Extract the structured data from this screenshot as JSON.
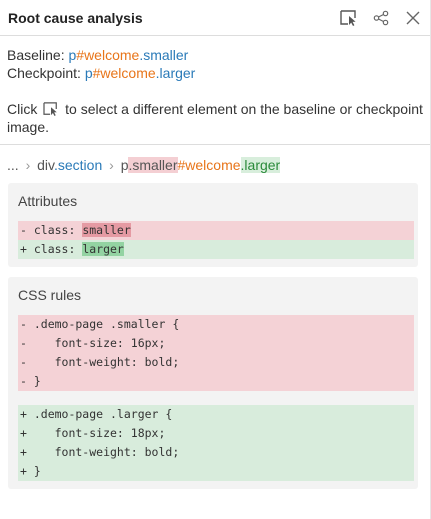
{
  "header": {
    "title": "Root cause analysis"
  },
  "info": {
    "baseline_label": "Baseline: ",
    "checkpoint_label": "Checkpoint: ",
    "baseline_tag": "p",
    "baseline_id": "#welcome",
    "baseline_class": ".smaller",
    "checkpoint_tag": "p",
    "checkpoint_id": "#welcome",
    "checkpoint_class": ".larger",
    "hint_before": "Click ",
    "hint_after": " to select a different element on the baseline or checkpoint image."
  },
  "breadcrumb": {
    "ellipsis": "...",
    "sep": "›",
    "parent_tag": "div",
    "parent_class": ".section",
    "elem_tag": "p",
    "elem_bad_class": ".smaller",
    "elem_id": "#welcome",
    "elem_good_class": ".larger"
  },
  "attributes": {
    "title": "Attributes",
    "del_prefix": "- class: ",
    "del_value": "smaller",
    "add_prefix": "+ class: ",
    "add_value": "larger"
  },
  "css_rules": {
    "title": "CSS rules",
    "removed": [
      "- .demo-page .smaller {",
      "-    font-size: 16px;",
      "-    font-weight: bold;",
      "- }"
    ],
    "added": [
      "+ .demo-page .larger {",
      "+    font-size: 18px;",
      "+    font-weight: bold;",
      "+ }"
    ]
  },
  "colors": {
    "link_blue": "#2a7ab8",
    "id_orange": "#e8751a",
    "removed_bg": "#f4d2d6",
    "added_bg": "#d8ecdc"
  }
}
